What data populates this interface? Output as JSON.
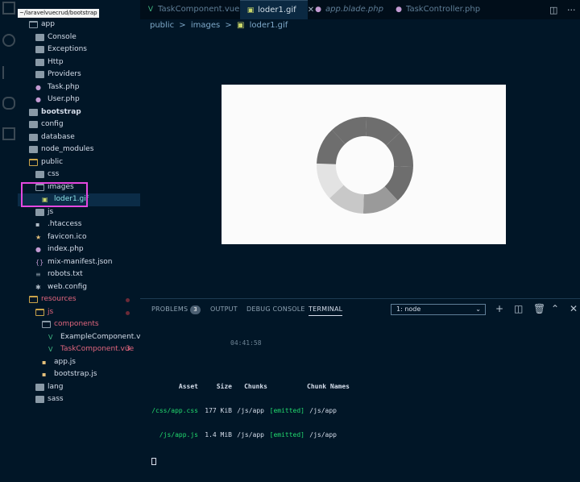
{
  "explorer": {
    "tooltip": "~/laravelvuecrud/bootstrap",
    "items": [
      {
        "label": "app",
        "type": "folder-open"
      },
      {
        "label": "Console",
        "type": "folder"
      },
      {
        "label": "Exceptions",
        "type": "folder"
      },
      {
        "label": "Http",
        "type": "folder"
      },
      {
        "label": "Providers",
        "type": "folder"
      },
      {
        "label": "Task.php",
        "type": "php"
      },
      {
        "label": "User.php",
        "type": "php"
      },
      {
        "label": "bootstrap",
        "type": "folder"
      },
      {
        "label": "config",
        "type": "folder"
      },
      {
        "label": "database",
        "type": "folder"
      },
      {
        "label": "node_modules",
        "type": "folder"
      },
      {
        "label": "public",
        "type": "folder-open"
      },
      {
        "label": "css",
        "type": "folder"
      },
      {
        "label": "images",
        "type": "folder-open"
      },
      {
        "label": "loder1.gif",
        "type": "image"
      },
      {
        "label": "js",
        "type": "folder"
      },
      {
        "label": ".htaccess",
        "type": "file"
      },
      {
        "label": "favicon.ico",
        "type": "star"
      },
      {
        "label": "index.php",
        "type": "php"
      },
      {
        "label": "mix-manifest.json",
        "type": "json"
      },
      {
        "label": "robots.txt",
        "type": "text"
      },
      {
        "label": "web.config",
        "type": "config"
      },
      {
        "label": "resources",
        "type": "folder-open"
      },
      {
        "label": "js",
        "type": "folder-open"
      },
      {
        "label": "components",
        "type": "folder-open"
      },
      {
        "label": "ExampleComponent.vue",
        "type": "vue"
      },
      {
        "label": "TaskComponent.vue",
        "type": "vue"
      },
      {
        "label": "app.js",
        "type": "js"
      },
      {
        "label": "bootstrap.js",
        "type": "js"
      },
      {
        "label": "lang",
        "type": "folder"
      },
      {
        "label": "sass",
        "type": "folder"
      }
    ],
    "task_component_problems": "3"
  },
  "tabs": [
    {
      "label": "TaskComponent.vue",
      "icon": "vue-icon"
    },
    {
      "label": "loder1.gif",
      "icon": "image-icon",
      "active": true
    },
    {
      "label": "app.blade.php",
      "icon": "php-icon"
    },
    {
      "label": "TaskController.php",
      "icon": "php-icon"
    }
  ],
  "breadcrumb": [
    "public",
    ">",
    "images",
    ">",
    "loder1.gif"
  ],
  "panel": {
    "tabs": {
      "problems": "PROBLEMS",
      "problems_count": "3",
      "output": "OUTPUT",
      "debug": "DEBUG CONSOLE",
      "terminal": "TERMINAL"
    },
    "terminal_select": "1: node",
    "time": "04:41:58",
    "header": {
      "asset": "Asset",
      "size": "Size",
      "chunks": "Chunks",
      "names": "Chunk Names"
    },
    "rows": [
      {
        "asset": "/css/app.css",
        "size": "177 KiB",
        "chunk": "/js/app",
        "status": "[emitted]",
        "name": "/js/app"
      },
      {
        "asset": "/js/app.js",
        "size": "1.4 MiB",
        "chunk": "/js/app",
        "status": "[emitted]",
        "name": "/js/app"
      }
    ]
  },
  "colors": {
    "bg": "#011627",
    "accent": "#d6deeb",
    "highlight": "#e548e0"
  }
}
